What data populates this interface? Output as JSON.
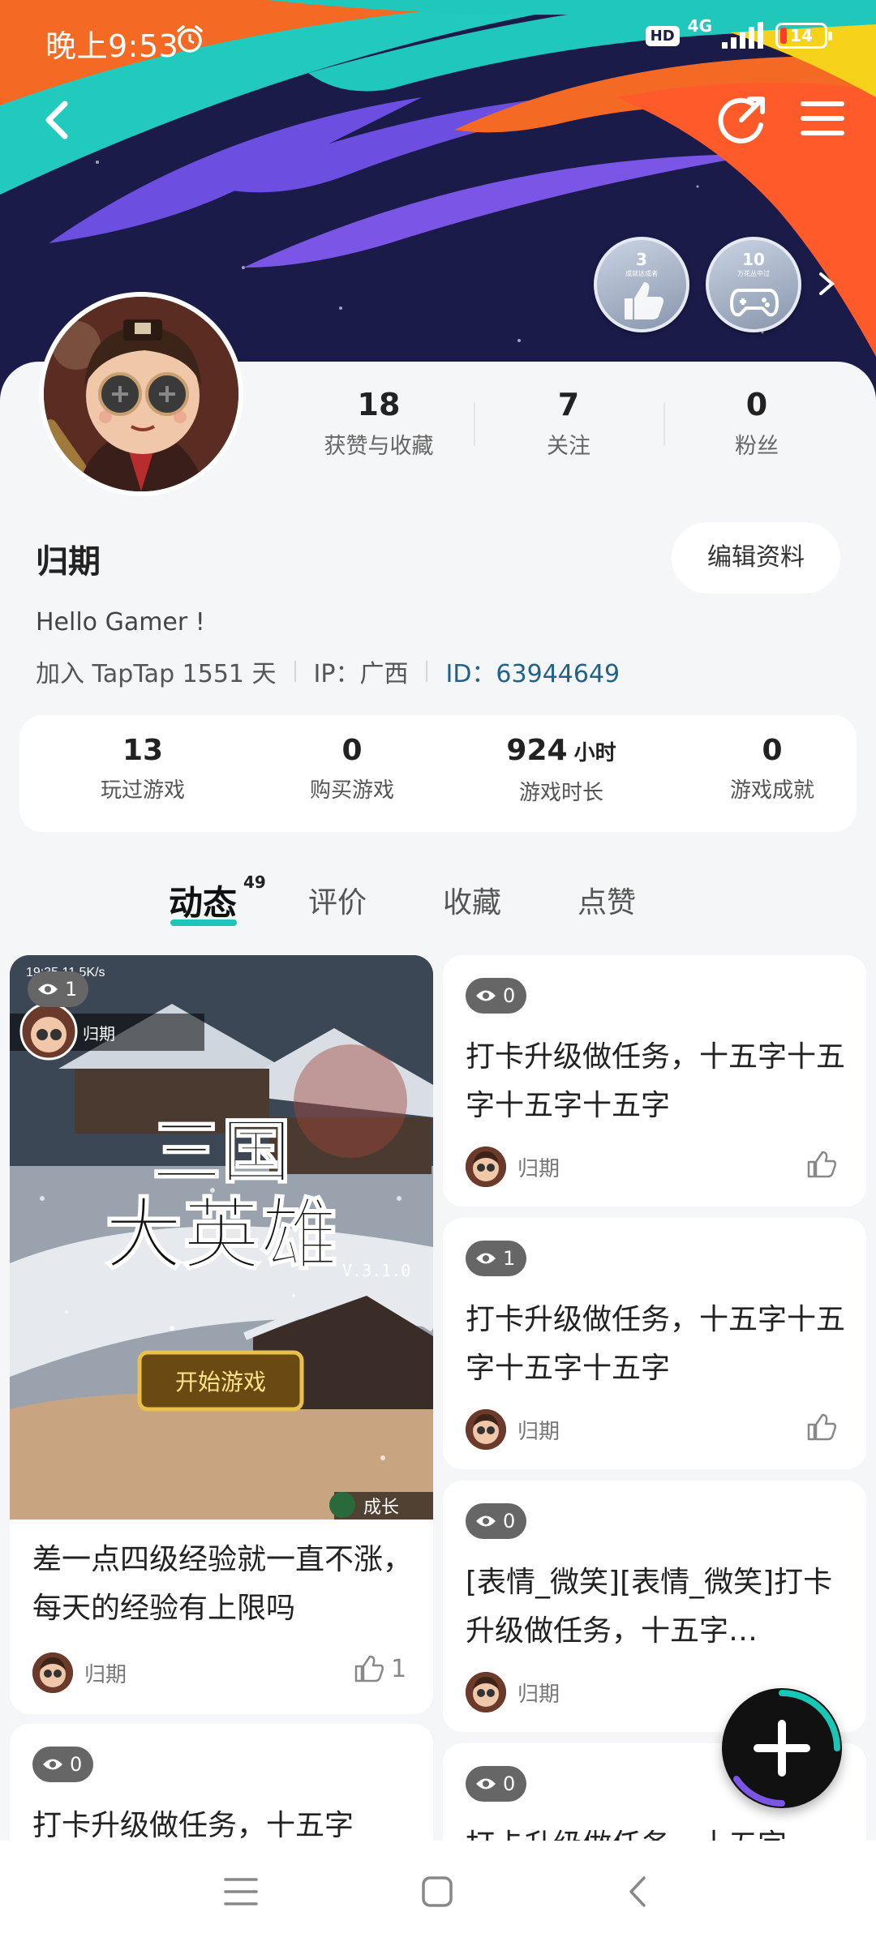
{
  "status_bar": {
    "time": "晚上9:53",
    "hd": "HD",
    "network": "4G",
    "battery": "14"
  },
  "header": {
    "back_icon": "back-arrow-icon",
    "share_icon": "share-icon",
    "menu_icon": "menu-icon"
  },
  "badges": [
    {
      "number": "3",
      "caption": "成就达成者",
      "icon": "thumbs-up-icon"
    },
    {
      "number": "10",
      "caption": "万花丛中过",
      "icon": "gamepad-icon"
    }
  ],
  "counts": [
    {
      "value": "18",
      "label": "获赞与收藏"
    },
    {
      "value": "7",
      "label": "关注"
    },
    {
      "value": "0",
      "label": "粉丝"
    }
  ],
  "profile": {
    "name": "归期",
    "edit_label": "编辑资料",
    "bio": "Hello Gamer !",
    "join": "加入 TapTap 1551 天",
    "ip": "IP：广西",
    "id": "ID：63944649"
  },
  "game_stats": [
    {
      "value": "13",
      "unit": "",
      "label": "玩过游戏"
    },
    {
      "value": "0",
      "unit": "",
      "label": "购买游戏"
    },
    {
      "value": "924",
      "unit": "小时",
      "label": "游戏时长"
    },
    {
      "value": "0",
      "unit": "",
      "label": "游戏成就"
    }
  ],
  "tabs": [
    {
      "label": "动态",
      "count": "49",
      "active": true
    },
    {
      "label": "评价"
    },
    {
      "label": "收藏"
    },
    {
      "label": "点赞"
    }
  ],
  "feed": {
    "left": [
      {
        "views": "1",
        "image": {
          "status": "19:35 11.5K/s",
          "user": "归期",
          "title_line1": "三国",
          "title_line2": "大英雄",
          "version": "V.3.1.0",
          "button": "开始游戏",
          "corner": "成长"
        },
        "title": "差一点四级经验就一直不涨，每天的经验有上限吗",
        "author": "归期",
        "likes": "1"
      },
      {
        "views": "0",
        "title": "打卡升级做任务，十五字"
      }
    ],
    "right": [
      {
        "views": "0",
        "title": "打卡升级做任务，十五字十五字十五字十五字",
        "author": "归期"
      },
      {
        "views": "1",
        "title": "打卡升级做任务，十五字十五字十五字十五字",
        "author": "归期"
      },
      {
        "views": "0",
        "title": "[表情_微笑][表情_微笑]打卡升级做任务，十五字…",
        "author": "归期"
      },
      {
        "views": "0",
        "title": "打卡升级做任务，十五字"
      }
    ]
  },
  "colors": {
    "accent": "#18c7b6",
    "id_link": "#20628a",
    "banner_bg": "#1b1b4a"
  }
}
